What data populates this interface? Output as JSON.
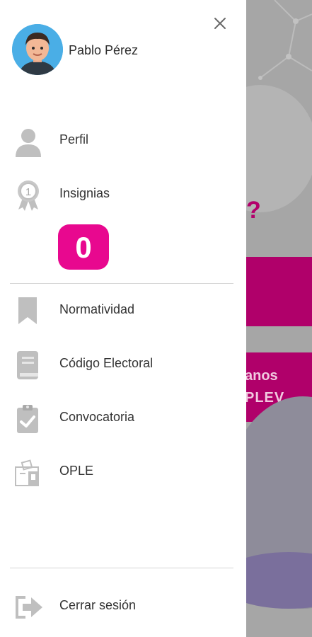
{
  "user": {
    "name": "Pablo Pérez"
  },
  "badge": {
    "count": "0"
  },
  "menu": [
    {
      "key": "perfil",
      "label": "Perfil",
      "icon": "user-icon"
    },
    {
      "key": "insignias",
      "label": "Insignias",
      "icon": "medal-icon"
    },
    {
      "key": "normatividad",
      "label": "Normatividad",
      "icon": "bookmark-icon"
    },
    {
      "key": "codigo",
      "label": "Código Electoral",
      "icon": "book-icon"
    },
    {
      "key": "convocatoria",
      "label": "Convocatoria",
      "icon": "clipboard-check-icon"
    },
    {
      "key": "ople",
      "label": "OPLE",
      "icon": "ballot-box-icon"
    }
  ],
  "logout": {
    "label": "Cerrar sesión",
    "icon": "logout-icon"
  },
  "background": {
    "band_text_line1": "anos",
    "band_text_line2": "PLEV",
    "question_mark": "?"
  },
  "colors": {
    "accent": "#e8088f",
    "band": "#b0006a",
    "icon_gray": "#bfbfbf",
    "overlay": "#a6a6a6"
  }
}
